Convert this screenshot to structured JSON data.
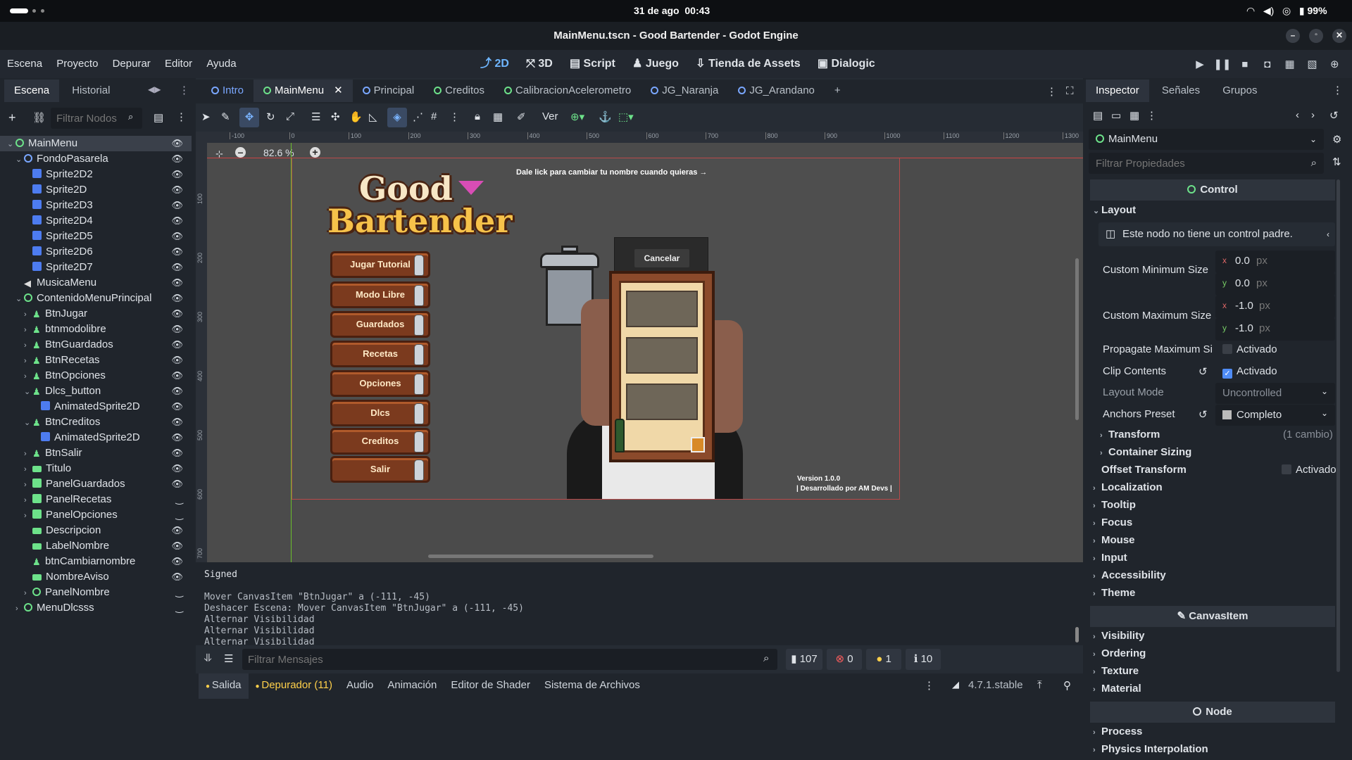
{
  "system_bar": {
    "date": "31 de ago",
    "time": "00:43",
    "battery": "99%"
  },
  "window": {
    "title": "MainMenu.tscn - Good Bartender - Godot Engine"
  },
  "menu": [
    "Escena",
    "Proyecto",
    "Depurar",
    "Editor",
    "Ayuda"
  ],
  "workspaces": [
    {
      "label": "2D",
      "icon": "2d-icon"
    },
    {
      "label": "3D",
      "icon": "3d-icon"
    },
    {
      "label": "Script",
      "icon": "script-icon"
    },
    {
      "label": "Juego",
      "icon": "game-icon"
    },
    {
      "label": "Tienda de Assets",
      "icon": "assetlib-icon"
    },
    {
      "label": "Dialogic",
      "icon": "dialogic-icon"
    }
  ],
  "scene_dock": {
    "tabs": [
      "Escena",
      "Historial"
    ],
    "filter_placeholder": "Filtrar Nodos",
    "nodes": [
      {
        "label": "MainMenu",
        "depth": 0,
        "type": "control",
        "arrow": "v",
        "selected": true
      },
      {
        "label": "FondoPasarela",
        "depth": 1,
        "type": "node2d",
        "arrow": "v"
      },
      {
        "label": "Sprite2D2",
        "depth": 2,
        "type": "sprite"
      },
      {
        "label": "Sprite2D",
        "depth": 2,
        "type": "sprite"
      },
      {
        "label": "Sprite2D3",
        "depth": 2,
        "type": "sprite"
      },
      {
        "label": "Sprite2D4",
        "depth": 2,
        "type": "sprite"
      },
      {
        "label": "Sprite2D5",
        "depth": 2,
        "type": "sprite"
      },
      {
        "label": "Sprite2D6",
        "depth": 2,
        "type": "sprite"
      },
      {
        "label": "Sprite2D7",
        "depth": 2,
        "type": "sprite"
      },
      {
        "label": "MusicaMenu",
        "depth": 1,
        "type": "audio"
      },
      {
        "label": "ContenidoMenuPrincipal",
        "depth": 1,
        "type": "control",
        "arrow": "v"
      },
      {
        "label": "BtnJugar",
        "depth": 2,
        "type": "button",
        "arrow": ">"
      },
      {
        "label": "btnmodolibre",
        "depth": 2,
        "type": "button",
        "arrow": ">"
      },
      {
        "label": "BtnGuardados",
        "depth": 2,
        "type": "button",
        "arrow": ">"
      },
      {
        "label": "BtnRecetas",
        "depth": 2,
        "type": "button",
        "arrow": ">"
      },
      {
        "label": "BtnOpciones",
        "depth": 2,
        "type": "button",
        "arrow": ">"
      },
      {
        "label": "Dlcs_button",
        "depth": 2,
        "type": "button",
        "arrow": "v"
      },
      {
        "label": "AnimatedSprite2D",
        "depth": 3,
        "type": "sprite"
      },
      {
        "label": "BtnCreditos",
        "depth": 2,
        "type": "button",
        "arrow": "v"
      },
      {
        "label": "AnimatedSprite2D",
        "depth": 3,
        "type": "sprite"
      },
      {
        "label": "BtnSalir",
        "depth": 2,
        "type": "button",
        "arrow": ">"
      },
      {
        "label": "Titulo",
        "depth": 2,
        "type": "label",
        "arrow": ">"
      },
      {
        "label": "PanelGuardados",
        "depth": 2,
        "type": "panel",
        "arrow": ">"
      },
      {
        "label": "PanelRecetas",
        "depth": 2,
        "type": "panel",
        "arrow": ">"
      },
      {
        "label": "PanelOpciones",
        "depth": 2,
        "type": "panel",
        "arrow": ">"
      },
      {
        "label": "Descripcion",
        "depth": 2,
        "type": "label"
      },
      {
        "label": "LabelNombre",
        "depth": 2,
        "type": "label"
      },
      {
        "label": "btnCambiarnombre",
        "depth": 2,
        "type": "button"
      },
      {
        "label": "NombreAviso",
        "depth": 2,
        "type": "label"
      },
      {
        "label": "PanelNombre",
        "depth": 2,
        "type": "control",
        "arrow": ">"
      },
      {
        "label": "MenuDlcsss",
        "depth": 1,
        "type": "control",
        "arrow": ">"
      }
    ]
  },
  "scene_tabs": [
    "Intro",
    "MainMenu",
    "Principal",
    "Creditos",
    "CalibracionAcelerometro",
    "JG_Naranja",
    "JG_Arandano"
  ],
  "toolbar": {
    "view_label": "Ver"
  },
  "viewport": {
    "zoom": "82.6 %",
    "ruler_marks": [
      "-100",
      "0",
      "100",
      "200",
      "300",
      "400",
      "500",
      "600",
      "700",
      "800",
      "900",
      "1000",
      "1100",
      "1200",
      "1300"
    ],
    "vruler_marks": [
      "100",
      "200",
      "300",
      "400",
      "500",
      "600",
      "700"
    ],
    "hint_text": "Dale lick para cambiar tu nombre cuando quieras →",
    "logo_line1": "Good",
    "logo_line2": "Bartender",
    "menu_buttons": [
      "Jugar Tutorial",
      "Modo Libre",
      "Guardados",
      "Recetas",
      "Opciones",
      "Dlcs",
      "Creditos",
      "Salir"
    ],
    "cancel_label": "Cancelar",
    "version": "Version 1.0.0",
    "credits": "| Desarrollado por AM Devs |"
  },
  "output": {
    "header": "Signed",
    "lines": [
      "Mover CanvasItem \"BtnJugar\" a (-111, -45)",
      "Deshacer Escena: Mover CanvasItem \"BtnJugar\" a (-111, -45)",
      "Alternar Visibilidad",
      "Alternar Visibilidad",
      "Alternar Visibilidad",
      "Alternar Visibilidad"
    ],
    "filter_placeholder": "Filtrar Mensajes",
    "counts": {
      "messages": "107",
      "errors": "0",
      "warnings": "1",
      "info": "10"
    }
  },
  "bottom_tabs": [
    "Salida",
    "Depurador (11)",
    "Audio",
    "Animación",
    "Editor de Shader",
    "Sistema de Archivos"
  ],
  "version_label": "4.7.1.stable",
  "inspector": {
    "tabs": [
      "Inspector",
      "Señales",
      "Grupos"
    ],
    "node_name": "MainMenu",
    "filter_placeholder": "Filtrar Propiedades",
    "control_title": "Control",
    "layout_title": "Layout",
    "no_parent_msg": "Este nodo no tiene un control padre.",
    "custom_min_label": "Custom Minimum Size",
    "min_x": "0.0",
    "min_y": "0.0",
    "custom_max_label": "Custom Maximum Size",
    "max_x": "-1.0",
    "max_y": "-1.0",
    "unit": "px",
    "propagate_label": "Propagate Maximum Si",
    "clip_label": "Clip Contents",
    "activado": "Activado",
    "layout_mode_label": "Layout Mode",
    "layout_mode_value": "Uncontrolled",
    "anchors_label": "Anchors Preset",
    "anchors_value": "Completo",
    "transform_label": "Transform",
    "transform_note": "(1 cambio)",
    "container_sizing": "Container Sizing",
    "offset_transform": "Offset Transform",
    "sections": [
      "Localization",
      "Tooltip",
      "Focus",
      "Mouse",
      "Input",
      "Accessibility",
      "Theme"
    ],
    "canvasitem_title": "CanvasItem",
    "canvas_sections": [
      "Visibility",
      "Ordering",
      "Texture",
      "Material"
    ],
    "node_title": "Node",
    "node_sections": [
      "Process",
      "Physics Interpolation"
    ]
  }
}
